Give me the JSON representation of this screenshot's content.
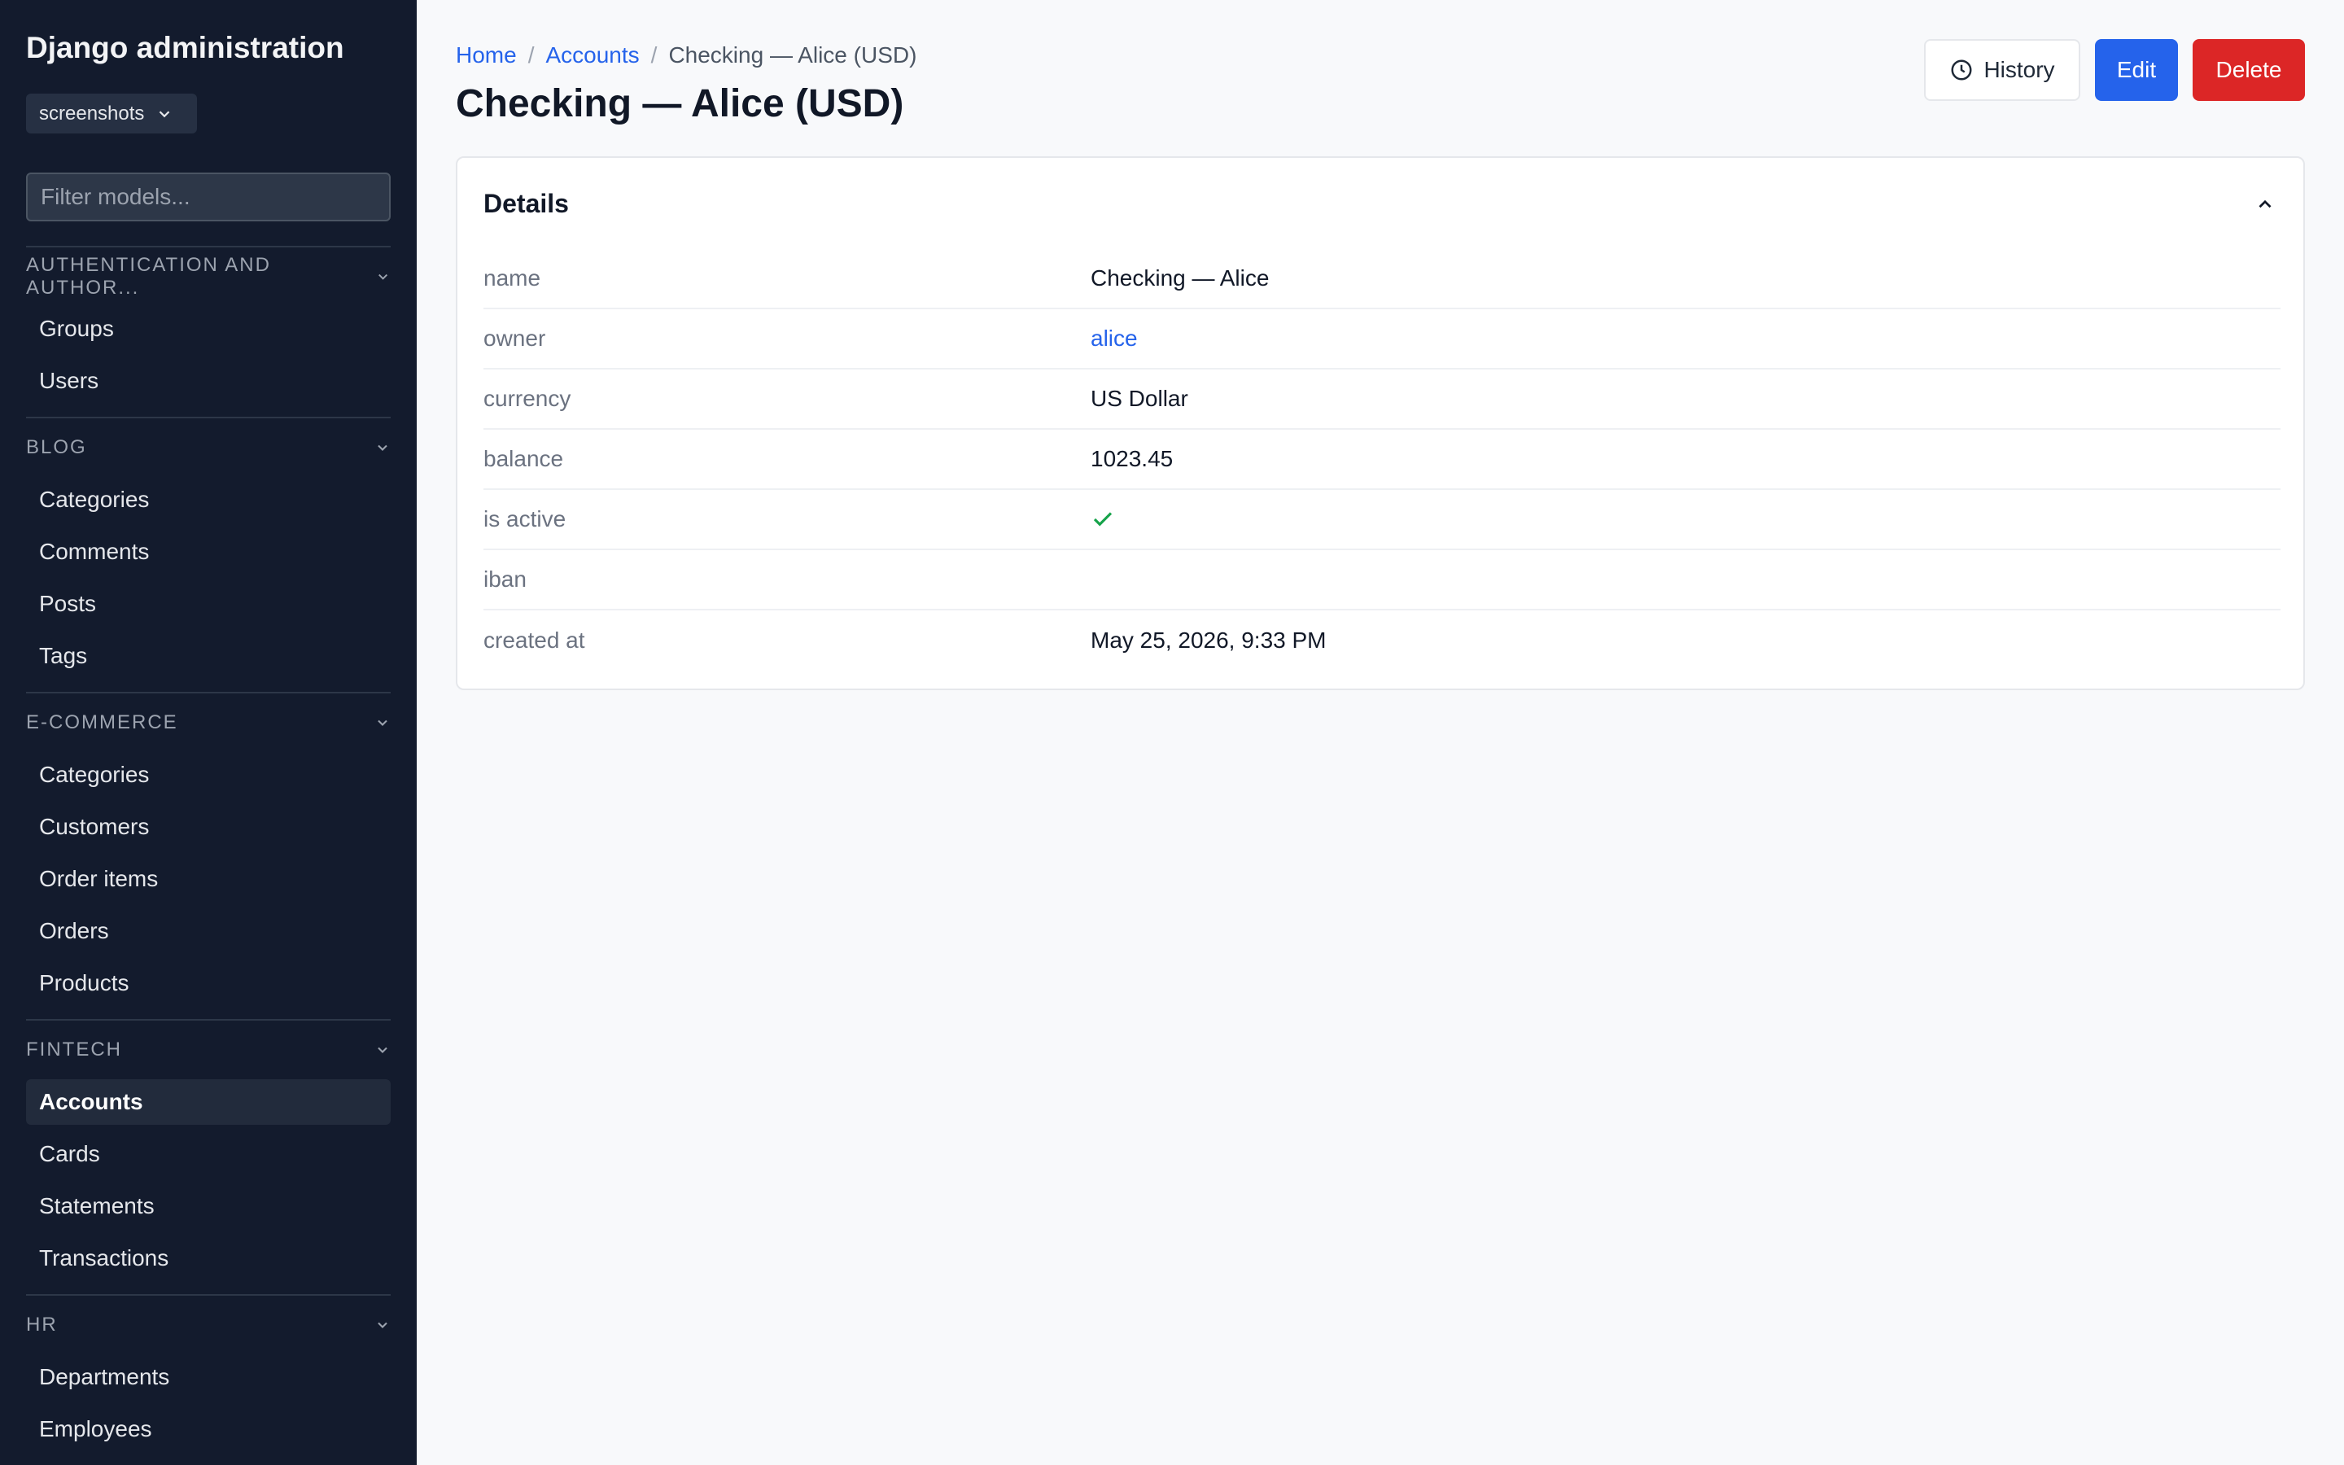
{
  "sidebar": {
    "brand": "Django administration",
    "site": "screenshots",
    "filter_placeholder": "Filter models...",
    "groups": [
      {
        "title": "AUTHENTICATION AND AUTHOR...",
        "items": [
          "Groups",
          "Users"
        ]
      },
      {
        "title": "BLOG",
        "items": [
          "Categories",
          "Comments",
          "Posts",
          "Tags"
        ]
      },
      {
        "title": "E-COMMERCE",
        "items": [
          "Categories",
          "Customers",
          "Order items",
          "Orders",
          "Products"
        ]
      },
      {
        "title": "FINTECH",
        "items": [
          "Accounts",
          "Cards",
          "Statements",
          "Transactions"
        ]
      },
      {
        "title": "HR",
        "items": [
          "Departments",
          "Employees"
        ]
      }
    ],
    "active_item": "Accounts"
  },
  "breadcrumb": {
    "home": "Home",
    "section": "Accounts",
    "current": "Checking — Alice (USD)",
    "separator": "/"
  },
  "page": {
    "title": "Checking — Alice (USD)"
  },
  "actions": {
    "history": "History",
    "edit": "Edit",
    "delete": "Delete"
  },
  "details": {
    "title": "Details",
    "fields": [
      {
        "label": "name",
        "value": "Checking — Alice"
      },
      {
        "label": "owner",
        "value": "alice"
      },
      {
        "label": "currency",
        "value": "US Dollar"
      },
      {
        "label": "balance",
        "value": "1023.45"
      },
      {
        "label": "is active",
        "value": true
      },
      {
        "label": "iban",
        "value": ""
      },
      {
        "label": "created at",
        "value": "May 25, 2026, 9:33 PM"
      }
    ]
  },
  "icons": {
    "site_dropdown": "chevron-down-icon",
    "group_toggle": "chevron-down-icon",
    "history": "clock-icon",
    "collapse": "chevron-up-icon",
    "is_active": "checkmark-icon"
  },
  "colors": {
    "sidebar_bg": "#131b2d",
    "link": "#2563eb",
    "edit": "#2563eb",
    "delete": "#dc2626",
    "success": "#16a34a"
  }
}
